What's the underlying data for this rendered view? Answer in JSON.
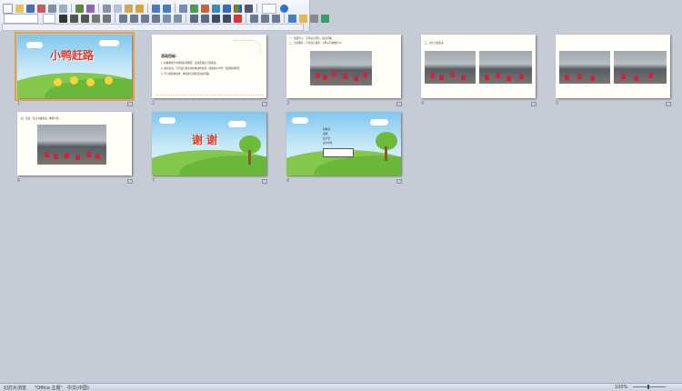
{
  "toolbar": {
    "row1_icons": [
      "new-icon",
      "open-icon",
      "save-icon",
      "permission-icon",
      "print-icon",
      "print-preview-icon",
      "spelling-icon",
      "research-icon",
      "cut-icon",
      "copy-icon",
      "paste-icon",
      "format-painter-icon",
      "undo-icon",
      "redo-icon",
      "insert-table-icon",
      "insert-chart-icon",
      "insert-picture-icon",
      "insert-shape-icon",
      "insert-hyperlink-icon",
      "color-icon",
      "expand-icon",
      "zoom-icon",
      "help-icon"
    ],
    "row2_icons": [
      "bold-icon",
      "italic-icon",
      "underline-icon",
      "shadow-icon",
      "strikethrough-icon",
      "align-left-icon",
      "align-center-icon",
      "align-right-icon",
      "justify-icon",
      "text-direction-icon",
      "columns-icon",
      "bullets-icon",
      "numbering-icon",
      "increase-font-icon",
      "decrease-font-icon",
      "font-color-icon",
      "indent-icon",
      "outdent-icon",
      "line-spacing-icon",
      "design-icon",
      "new-slide-icon",
      "layout-icon",
      "animation-icon"
    ]
  },
  "slides": [
    {
      "num": "1",
      "type": "title",
      "title": "小鸭赶路",
      "selected": true
    },
    {
      "num": "2",
      "type": "text",
      "heading": "活动目标：",
      "lines": [
        "1. 在故事情节中感知并用图形，尝试表述自己的看法。",
        "2. 通过表演，引导幼儿愿意用身体动作表现，感受和小伙伴一起游戏的快乐。",
        "3. 学习用肢体动作，体验参与游戏活动的乐趣。"
      ]
    },
    {
      "num": "3",
      "type": "photo-text",
      "lines": [
        "一、谈话导入：引导幼儿回忆，提出问题。",
        "二、出示图片，引导幼儿观察：小鸭子们在做什么？"
      ]
    },
    {
      "num": "4",
      "type": "two-photos",
      "caption": "三、幼儿分组表演"
    },
    {
      "num": "5",
      "type": "two-photos",
      "caption": ""
    },
    {
      "num": "6",
      "type": "photo-text",
      "lines": [
        "四、结束：幼儿自由表演，教师小结。"
      ]
    },
    {
      "num": "7",
      "type": "title",
      "title": "谢 谢"
    },
    {
      "num": "8",
      "type": "scene-text",
      "lines": [
        "执教者：",
        "课题：",
        "设计者：",
        "设计单位："
      ]
    }
  ],
  "statusbar": {
    "view": "幻灯片浏览",
    "theme": "\"Office 主题\"",
    "language": "中文(中国)",
    "zoom": "100%"
  },
  "colors": {
    "background": "#c6ccd6",
    "selected_outline": "#e4a14a",
    "title_red": "#e23c2c"
  }
}
